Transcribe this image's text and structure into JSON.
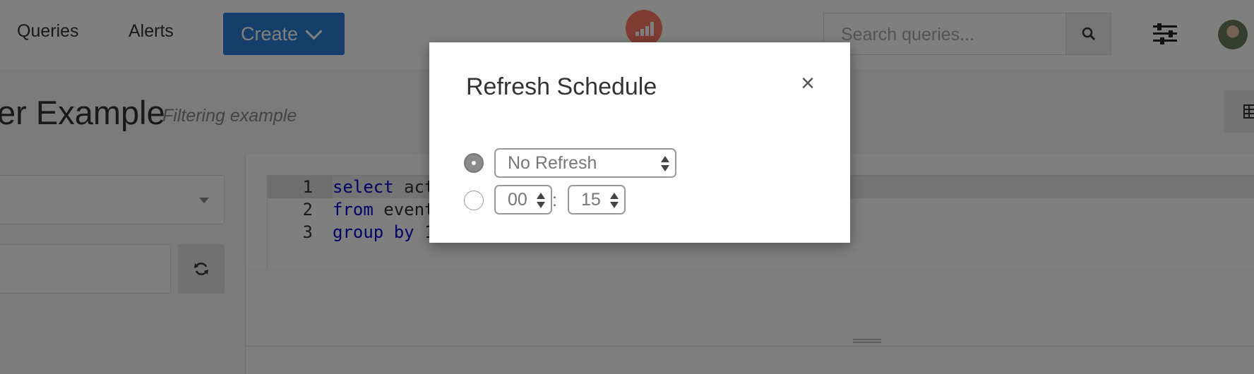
{
  "nav": {
    "queries_label": "Queries",
    "alerts_label": "Alerts",
    "create_label": "Create",
    "search_placeholder": "Search queries..."
  },
  "page": {
    "title": "er Example",
    "subtitle": "Filtering example"
  },
  "editor": {
    "lines": [
      {
        "number": "1",
        "keyword": "select",
        "rest": " act"
      },
      {
        "number": "2",
        "keyword": "from",
        "rest": " event"
      },
      {
        "number": "3",
        "keyword": "group by",
        "rest": " 1"
      }
    ]
  },
  "modal": {
    "title": "Refresh Schedule",
    "close_symbol": "×",
    "interval_selected": "No Refresh",
    "hour_value": "00",
    "time_separator": ":",
    "minute_value": "15"
  },
  "colors": {
    "create_button": "#2a7fd4",
    "logo": "#ff7964",
    "keyword": "#0000cc"
  },
  "icons": [
    "chevron-down-icon",
    "redash-logo-icon",
    "search-icon",
    "settings-sliders-icon",
    "table-icon",
    "refresh-icon",
    "close-icon"
  ]
}
